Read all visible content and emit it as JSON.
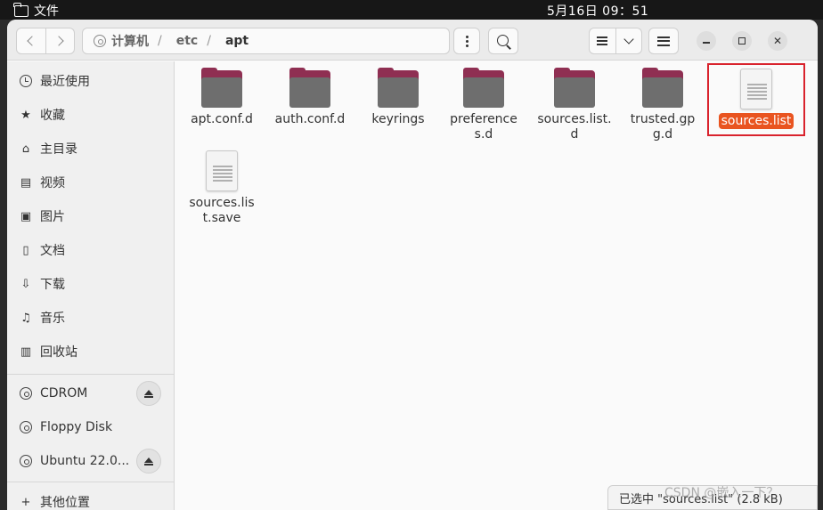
{
  "top_panel": {
    "app_label": "文件",
    "clock": "5月16日  09：51"
  },
  "path": {
    "segments": [
      "计算机",
      "etc",
      "apt"
    ],
    "separator": "/"
  },
  "sidebar": {
    "places": [
      {
        "label": "最近使用",
        "icon": "clock-icon"
      },
      {
        "label": "收藏",
        "icon": "star-icon"
      },
      {
        "label": "主目录",
        "icon": "home-icon"
      },
      {
        "label": "视频",
        "icon": "video-icon"
      },
      {
        "label": "图片",
        "icon": "image-icon"
      },
      {
        "label": "文档",
        "icon": "document-icon"
      },
      {
        "label": "下载",
        "icon": "download-icon"
      },
      {
        "label": "音乐",
        "icon": "music-icon"
      },
      {
        "label": "回收站",
        "icon": "trash-icon"
      }
    ],
    "devices": [
      {
        "label": "CDROM",
        "icon": "disc-icon",
        "ejectable": true
      },
      {
        "label": "Floppy Disk",
        "icon": "disc-icon",
        "ejectable": false
      },
      {
        "label": "Ubuntu 22.0...",
        "icon": "disc-icon",
        "ejectable": true
      }
    ],
    "other": {
      "label": "其他位置",
      "icon": "plus-icon"
    }
  },
  "files": [
    {
      "name": "apt.conf.d",
      "type": "folder"
    },
    {
      "name": "auth.conf.d",
      "type": "folder"
    },
    {
      "name": "keyrings",
      "type": "folder"
    },
    {
      "name": "preferences.d",
      "type": "folder"
    },
    {
      "name": "sources.list.d",
      "type": "folder"
    },
    {
      "name": "trusted.gpg.d",
      "type": "folder"
    },
    {
      "name": "sources.list",
      "type": "file",
      "selected": true
    },
    {
      "name": "sources.list.save",
      "type": "file"
    }
  ],
  "status": {
    "text": "已选中 \"sources.list\" (2.8 kB)"
  },
  "watermark": "CSDN @嵌入一下？",
  "colors": {
    "accent": "#e95420",
    "folder_tab": "#8f2f52",
    "folder_body": "#6e6e6e",
    "highlight_box": "#d9232d"
  }
}
